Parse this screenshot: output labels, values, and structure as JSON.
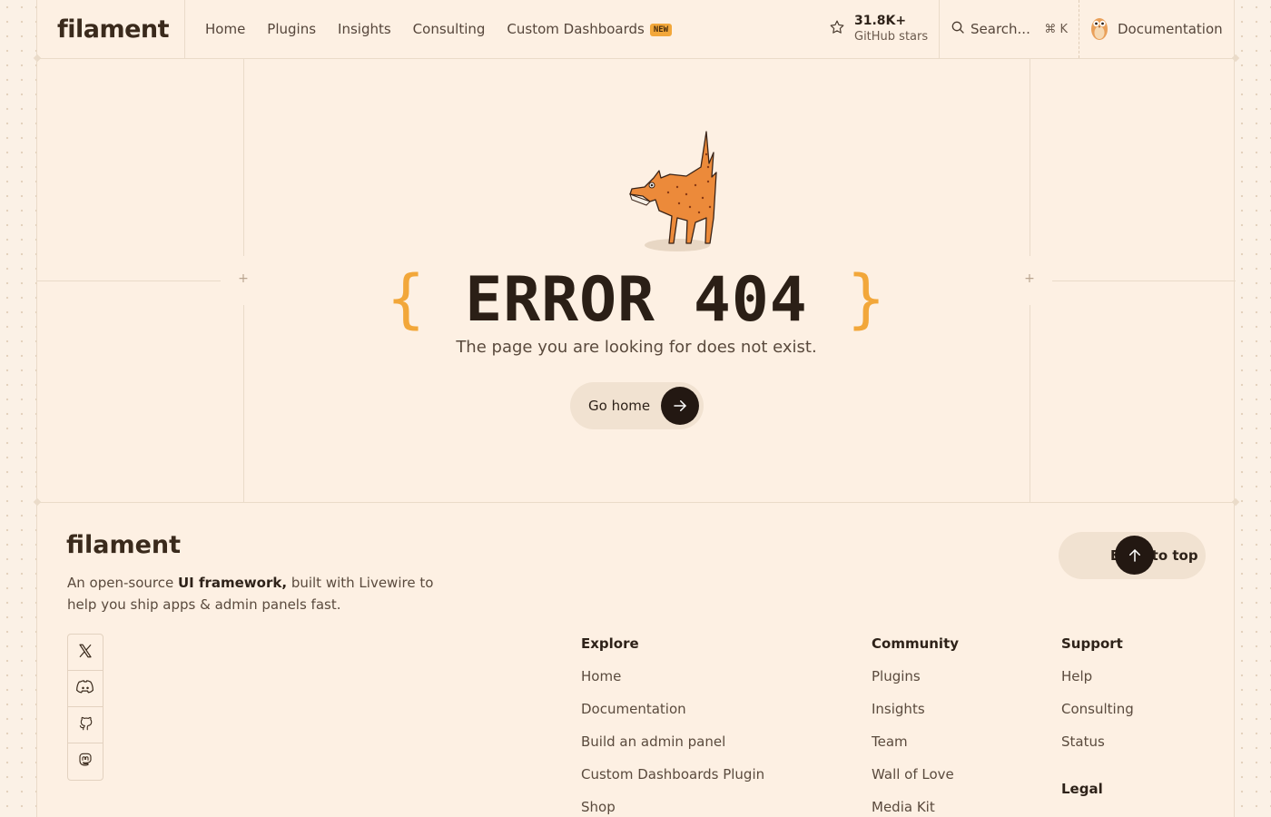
{
  "header": {
    "logo": "filament",
    "nav": [
      "Home",
      "Plugins",
      "Insights",
      "Consulting",
      "Custom Dashboards"
    ],
    "nav_badge": "NEW",
    "stars_count": "31.8K+",
    "stars_label": "GitHub stars",
    "search_placeholder": "Search...",
    "search_shortcut": "⌘ K",
    "docs_label": "Documentation"
  },
  "hero": {
    "title": "ERROR 404",
    "subtitle": "The page you are looking for does not exist.",
    "cta": "Go home"
  },
  "footer": {
    "logo": "filament",
    "tagline_pre": "An open-source ",
    "tagline_bold": "UI framework,",
    "tagline_post": " built with Livewire to help you ship apps & admin panels fast.",
    "back_to_top": "Back to top",
    "socials": [
      "x-icon",
      "discord-icon",
      "github-icon",
      "mastodon-icon"
    ],
    "explore": {
      "title": "Explore",
      "links": [
        "Home",
        "Documentation",
        "Build an admin panel",
        "Custom Dashboards Plugin",
        "Shop"
      ]
    },
    "community": {
      "title": "Community",
      "links": [
        "Plugins",
        "Insights",
        "Team",
        "Wall of Love",
        "Media Kit"
      ]
    },
    "support": {
      "title": "Support",
      "links": [
        "Help",
        "Consulting",
        "Status"
      ]
    },
    "legal": {
      "title": "Legal"
    }
  },
  "colors": {
    "accent": "#f2a73a",
    "dark": "#231812",
    "background": "#fdf0e3"
  }
}
